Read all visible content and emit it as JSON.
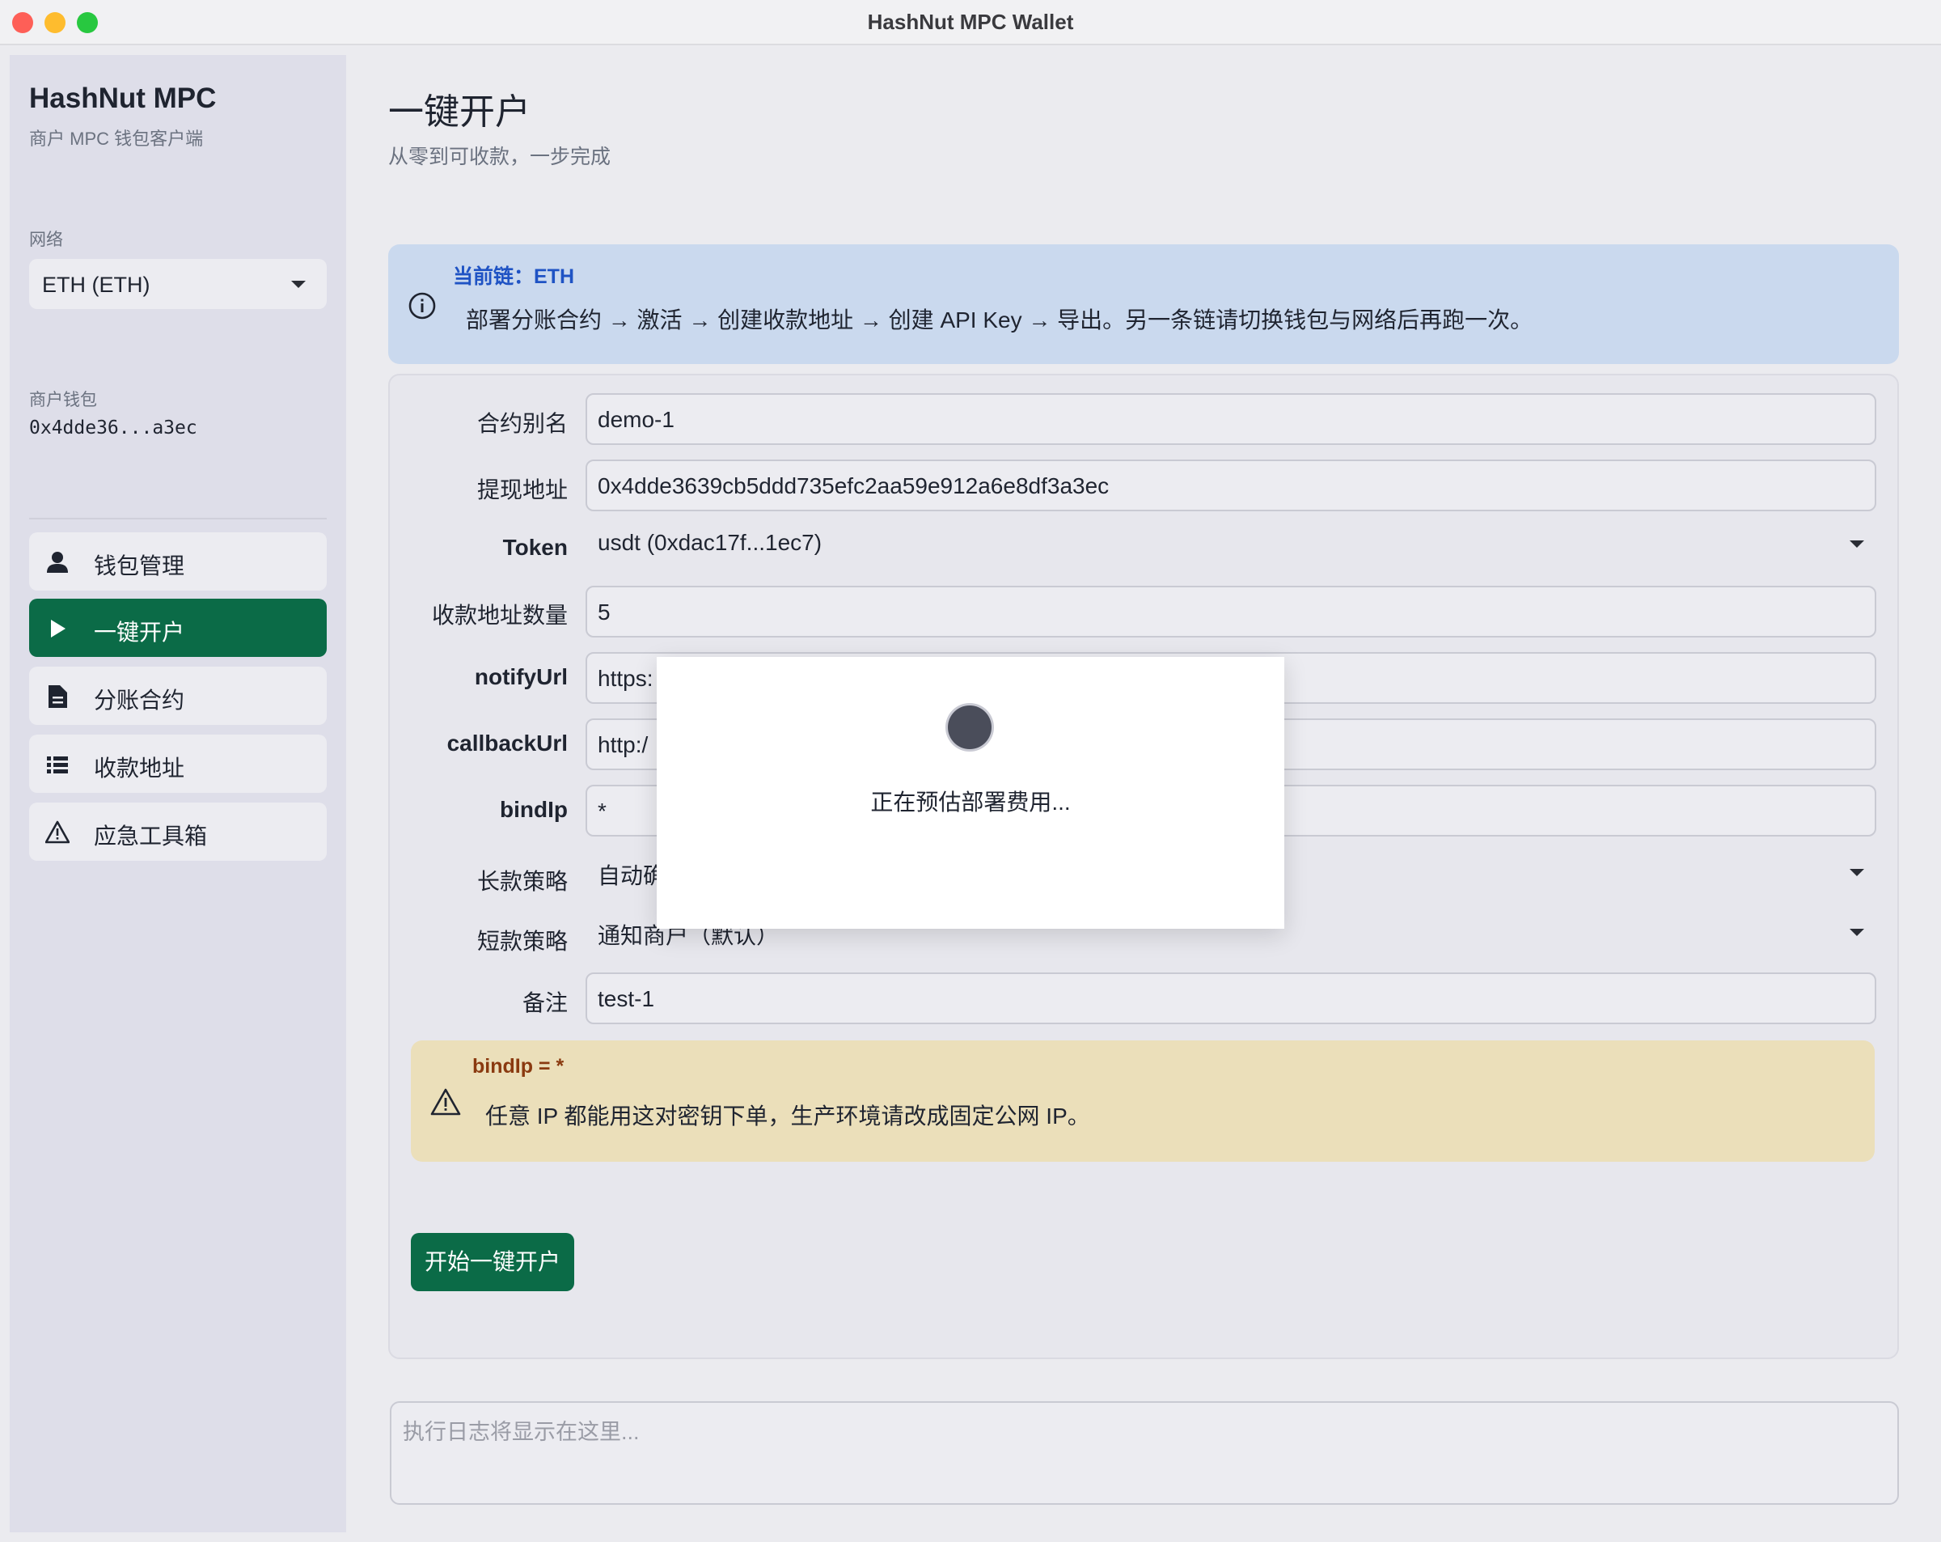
{
  "window": {
    "title": "HashNut MPC Wallet"
  },
  "sidebar": {
    "brand": "HashNut MPC",
    "brand_sub": "商户 MPC 钱包客户端",
    "network_label": "网络",
    "network_value": "ETH (ETH)",
    "wallet_label": "商户钱包",
    "wallet_address": "0x4dde36...a3ec",
    "items": [
      {
        "label": "钱包管理",
        "icon": "user-icon",
        "active": false
      },
      {
        "label": "一键开户",
        "icon": "play-icon",
        "active": true
      },
      {
        "label": "分账合约",
        "icon": "document-icon",
        "active": false
      },
      {
        "label": "收款地址",
        "icon": "list-icon",
        "active": false
      },
      {
        "label": "应急工具箱",
        "icon": "warning-icon",
        "active": false
      }
    ]
  },
  "main": {
    "title": "一键开户",
    "subtitle": "从零到可收款，一步完成",
    "info": {
      "title": "当前链：ETH",
      "text": "部署分账合约 → 激活 → 创建收款地址 → 创建 API Key → 导出。另一条链请切换钱包与网络后再跑一次。"
    },
    "form": {
      "alias_label": "合约别名",
      "alias_value": "demo-1",
      "withdraw_label": "提现地址",
      "withdraw_value": "0x4dde3639cb5ddd735efc2aa59e912a6e8df3a3ec",
      "token_label": "Token",
      "token_value": "usdt (0xdac17f...1ec7)",
      "count_label": "收款地址数量",
      "count_value": "5",
      "notify_label": "notifyUrl",
      "notify_value": "https:",
      "callback_label": "callbackUrl",
      "callback_value": "http:/",
      "bindip_label": "bindIp",
      "bindip_value": "*",
      "long_label": "长款策略",
      "long_value": "自动确",
      "short_label": "短款策略",
      "short_value": "通知商户（默认）",
      "note_label": "备注",
      "note_value": "test-1"
    },
    "warning": {
      "title": "bindIp = *",
      "text": "任意 IP 都能用这对密钥下单，生产环境请改成固定公网 IP。"
    },
    "start_button": "开始一键开户",
    "log_placeholder": "执行日志将显示在这里..."
  },
  "modal": {
    "text": "正在预估部署费用..."
  },
  "colors": {
    "accent": "#0b6b47",
    "info_bg": "#cad9ee",
    "warn_bg": "#ebdfba",
    "info_title": "#1f53c4",
    "warn_title": "#8a3a10"
  }
}
